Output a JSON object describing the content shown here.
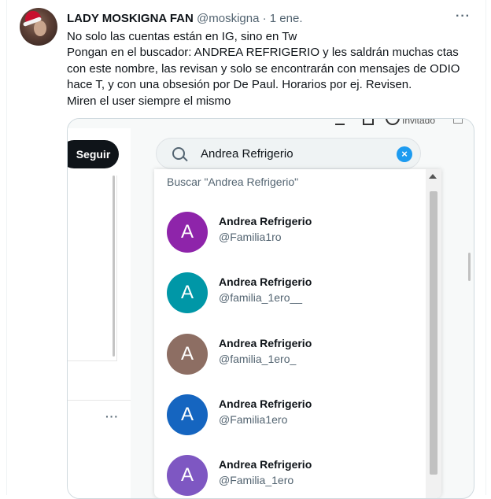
{
  "tweet": {
    "name": "LADY MOSKIGNA FAN",
    "handle": "@moskigna",
    "dot": "·",
    "date": "1 ene.",
    "more_icon": "···",
    "lines": [
      "No solo las cuentas están en IG, sino en Tw",
      "Pongan en el buscador: ANDREA REFRIGERIO y les saldrán muchas ctas",
      "con este nombre, las revisan y solo se encontrarán con mensajes de ODIO",
      "hace T, y con una obsesión por De Paul. Horarios por ej. Revisen.",
      "Miren el user siempre el mismo"
    ]
  },
  "screenshot": {
    "top_label": "Invitado",
    "follow_button": "Seguir",
    "left_more": "···",
    "search": {
      "value": "Andrea Refrigerio",
      "clear_icon": "×"
    },
    "suggestion": "Buscar \"Andrea Refrigerio\"",
    "results": [
      {
        "initial": "A",
        "name": "Andrea Refrigerio",
        "handle": "@Familia1ro",
        "color": "#8e24aa"
      },
      {
        "initial": "A",
        "name": "Andrea Refrigerio",
        "handle": "@familia_1ero__",
        "color": "#0097a7"
      },
      {
        "initial": "A",
        "name": "Andrea Refrigerio",
        "handle": "@familia_1ero_",
        "color": "#8d6e63"
      },
      {
        "initial": "A",
        "name": "Andrea Refrigerio",
        "handle": "@Familia1ero",
        "color": "#1565c0"
      },
      {
        "initial": "A",
        "name": "Andrea Refrigerio",
        "handle": "@Familia_1ero",
        "color": "#7e57c2"
      }
    ]
  }
}
